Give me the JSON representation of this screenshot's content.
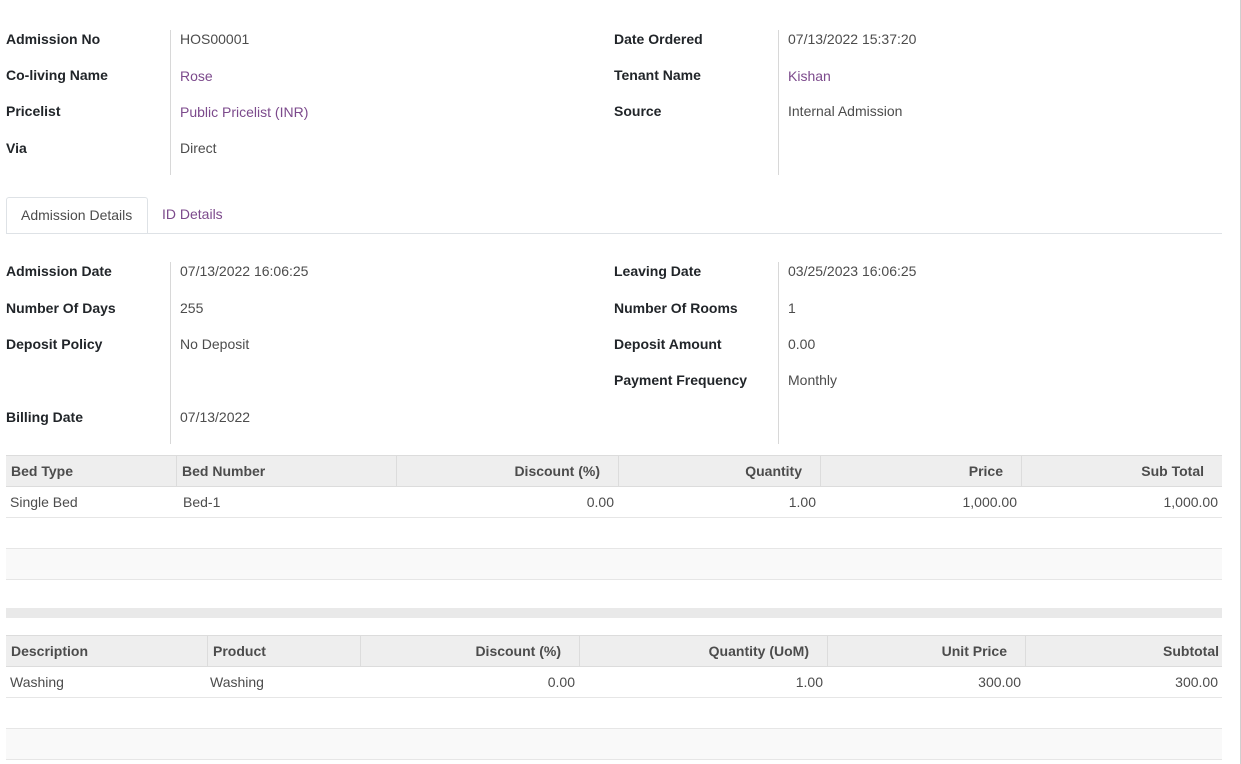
{
  "header": {
    "left": [
      {
        "label": "Admission No",
        "value": "HOS00001"
      },
      {
        "label": "Co-living Name",
        "value": "Rose"
      },
      {
        "label": "Pricelist",
        "value": "Public Pricelist (INR)"
      },
      {
        "label": "Via",
        "value": "Direct"
      }
    ],
    "right": [
      {
        "label": "Date Ordered",
        "value": "07/13/2022 15:37:20"
      },
      {
        "label": "Tenant Name",
        "value": "Kishan"
      },
      {
        "label": "Source",
        "value": "Internal Admission"
      }
    ]
  },
  "tabs": [
    {
      "label": "Admission Details"
    },
    {
      "label": "ID Details"
    }
  ],
  "details": {
    "left": [
      {
        "label": "Admission Date",
        "value": "07/13/2022 16:06:25"
      },
      {
        "label": "Number Of Days",
        "value": "255"
      },
      {
        "label": "Deposit Policy",
        "value": "No Deposit"
      },
      {
        "label": "Billing Date",
        "value": "07/13/2022"
      }
    ],
    "right": [
      {
        "label": "Leaving Date",
        "value": "03/25/2023 16:06:25"
      },
      {
        "label": "Number Of Rooms",
        "value": "1"
      },
      {
        "label": "Deposit Amount",
        "value": "0.00"
      },
      {
        "label": "Payment Frequency",
        "value": "Monthly"
      }
    ]
  },
  "bed_table": {
    "columns": [
      "Bed Type",
      "Bed Number",
      "Discount (%)",
      "Quantity",
      "Price",
      "Sub Total"
    ],
    "rows": [
      [
        "Single Bed",
        "Bed-1",
        "0.00",
        "1.00",
        "1,000.00",
        "1,000.00"
      ]
    ]
  },
  "service_table": {
    "columns": [
      "Description",
      "Product",
      "Discount (%)",
      "Quantity (UoM)",
      "Unit Price",
      "Subtotal"
    ],
    "rows": [
      [
        "Washing",
        "Washing",
        "0.00",
        "1.00",
        "300.00",
        "300.00"
      ]
    ]
  }
}
